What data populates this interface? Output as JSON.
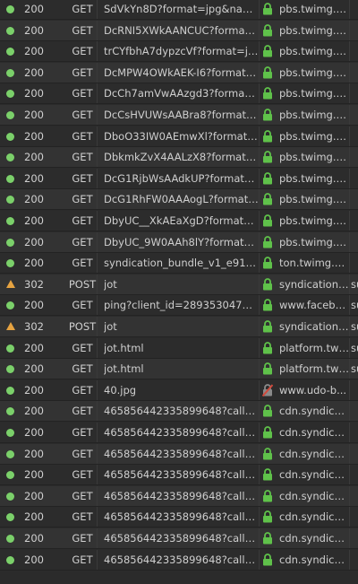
{
  "colors": {
    "ok": "#7bd06a",
    "redirect": "#e6a341",
    "secure": "#5fc14a",
    "insecure": "#d04a3c"
  },
  "requests": [
    {
      "status": "200",
      "method": "GET",
      "file": "SdVkYn8D?format=jpg&name...",
      "domain": "pbs.twimg.c...",
      "extra": "",
      "status_icon": "green-dot-icon",
      "security": "lock-icon"
    },
    {
      "status": "200",
      "method": "GET",
      "file": "DcRNI5XWkAANCUC?format=...",
      "domain": "pbs.twimg.c...",
      "extra": "",
      "status_icon": "green-dot-icon",
      "security": "lock-icon"
    },
    {
      "status": "200",
      "method": "GET",
      "file": "trCYfbhA7dypzcVf?format=jp...",
      "domain": "pbs.twimg.c...",
      "extra": "",
      "status_icon": "green-dot-icon",
      "security": "lock-icon"
    },
    {
      "status": "200",
      "method": "GET",
      "file": "DcMPW4OWkAEK-I6?format=...",
      "domain": "pbs.twimg.c...",
      "extra": "",
      "status_icon": "green-dot-icon",
      "security": "lock-icon"
    },
    {
      "status": "200",
      "method": "GET",
      "file": "DcCh7amVwAAzgd3?format=j...",
      "domain": "pbs.twimg.c...",
      "extra": "",
      "status_icon": "green-dot-icon",
      "security": "lock-icon"
    },
    {
      "status": "200",
      "method": "GET",
      "file": "DcCsHVUWsAABra8?format=...",
      "domain": "pbs.twimg.c...",
      "extra": "",
      "status_icon": "green-dot-icon",
      "security": "lock-icon"
    },
    {
      "status": "200",
      "method": "GET",
      "file": "DboO33IW0AEmwXl?format=j...",
      "domain": "pbs.twimg.c...",
      "extra": "",
      "status_icon": "green-dot-icon",
      "security": "lock-icon"
    },
    {
      "status": "200",
      "method": "GET",
      "file": "DbkmkZvX4AALzX8?format=j...",
      "domain": "pbs.twimg.c...",
      "extra": "",
      "status_icon": "green-dot-icon",
      "security": "lock-icon"
    },
    {
      "status": "200",
      "method": "GET",
      "file": "DcG1RjbWsAAdkUP?format=j...",
      "domain": "pbs.twimg.c...",
      "extra": "",
      "status_icon": "green-dot-icon",
      "security": "lock-icon"
    },
    {
      "status": "200",
      "method": "GET",
      "file": "DcG1RhFW0AAAogL?format=j...",
      "domain": "pbs.twimg.c...",
      "extra": "",
      "status_icon": "green-dot-icon",
      "security": "lock-icon"
    },
    {
      "status": "200",
      "method": "GET",
      "file": "DbyUC__XkAEaXgD?format=jp...",
      "domain": "pbs.twimg.c...",
      "extra": "",
      "status_icon": "green-dot-icon",
      "security": "lock-icon"
    },
    {
      "status": "200",
      "method": "GET",
      "file": "DbyUC_9W0AAh8lY?format=j...",
      "domain": "pbs.twimg.c...",
      "extra": "",
      "status_icon": "green-dot-icon",
      "security": "lock-icon"
    },
    {
      "status": "200",
      "method": "GET",
      "file": "syndication_bundle_v1_e919b...",
      "domain": "ton.twimg.c...",
      "extra": "",
      "status_icon": "green-dot-icon",
      "security": "lock-icon"
    },
    {
      "status": "302",
      "method": "POST",
      "file": "jot",
      "domain": "syndication....",
      "extra": "su",
      "status_icon": "warning-triangle-icon",
      "security": "lock-icon"
    },
    {
      "status": "200",
      "method": "GET",
      "file": "ping?client_id=289353047280...",
      "domain": "www.facebo...",
      "extra": "su",
      "status_icon": "green-dot-icon",
      "security": "lock-icon"
    },
    {
      "status": "302",
      "method": "POST",
      "file": "jot",
      "domain": "syndication....",
      "extra": "su",
      "status_icon": "warning-triangle-icon",
      "security": "lock-icon"
    },
    {
      "status": "200",
      "method": "GET",
      "file": "jot.html",
      "domain": "platform.twi...",
      "extra": "su",
      "status_icon": "green-dot-icon",
      "security": "lock-icon"
    },
    {
      "status": "200",
      "method": "GET",
      "file": "jot.html",
      "domain": "platform.twi...",
      "extra": "su",
      "status_icon": "green-dot-icon",
      "security": "lock-icon"
    },
    {
      "status": "200",
      "method": "GET",
      "file": "40.jpg",
      "domain": "www.udo-b...",
      "extra": "",
      "status_icon": "green-dot-icon",
      "security": "insecure-lock-icon"
    },
    {
      "status": "200",
      "method": "GET",
      "file": "465856442335899648?callback...",
      "domain": "cdn.syndicat...",
      "extra": "",
      "status_icon": "green-dot-icon",
      "security": "lock-icon"
    },
    {
      "status": "200",
      "method": "GET",
      "file": "465856442335899648?callback...",
      "domain": "cdn.syndicat...",
      "extra": "",
      "status_icon": "green-dot-icon",
      "security": "lock-icon"
    },
    {
      "status": "200",
      "method": "GET",
      "file": "465856442335899648?callback...",
      "domain": "cdn.syndicat...",
      "extra": "",
      "status_icon": "green-dot-icon",
      "security": "lock-icon"
    },
    {
      "status": "200",
      "method": "GET",
      "file": "465856442335899648?callback...",
      "domain": "cdn.syndicat...",
      "extra": "",
      "status_icon": "green-dot-icon",
      "security": "lock-icon"
    },
    {
      "status": "200",
      "method": "GET",
      "file": "465856442335899648?callback...",
      "domain": "cdn.syndicat...",
      "extra": "",
      "status_icon": "green-dot-icon",
      "security": "lock-icon"
    },
    {
      "status": "200",
      "method": "GET",
      "file": "465856442335899648?callback...",
      "domain": "cdn.syndicat...",
      "extra": "",
      "status_icon": "green-dot-icon",
      "security": "lock-icon"
    },
    {
      "status": "200",
      "method": "GET",
      "file": "465856442335899648?callback...",
      "domain": "cdn.syndicat...",
      "extra": "",
      "status_icon": "green-dot-icon",
      "security": "lock-icon"
    },
    {
      "status": "200",
      "method": "GET",
      "file": "465856442335899648?callback...",
      "domain": "cdn.syndicat...",
      "extra": "",
      "status_icon": "green-dot-icon",
      "security": "lock-icon"
    }
  ]
}
